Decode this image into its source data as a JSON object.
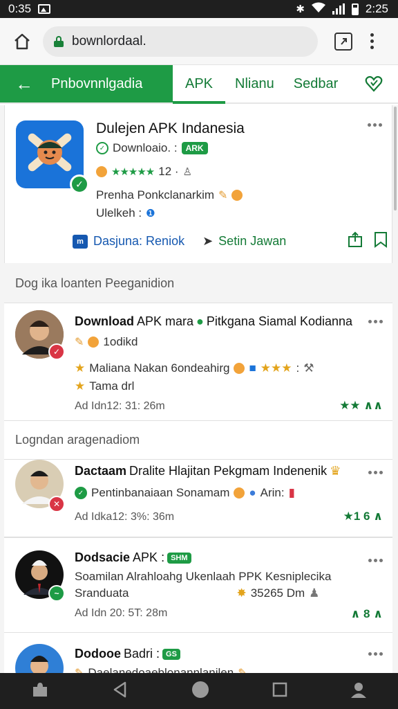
{
  "status_bar": {
    "left_time": "0:35",
    "right_time": "2:25"
  },
  "browser": {
    "url": "bownlordaal."
  },
  "tabs": [
    {
      "label": "Pnbovnnlgadia",
      "active": true
    },
    {
      "label": "APK"
    },
    {
      "label": "Nlianu"
    },
    {
      "label": "Sedbar"
    }
  ],
  "app": {
    "title": "Dulejen APK Indanesia",
    "meta_label": "Downloaio. :",
    "meta_badge": "ARK",
    "rating_count": "12 ·",
    "description": "Prenha Ponkclanarkim",
    "detail": "Ulelkeh :",
    "primary_action": "Dasjuna: Reniok",
    "primary_action_icon": "m",
    "secondary_action": "Setin Jawan"
  },
  "section_headers": [
    "Dog ika loanten Peeganidion",
    "Logndan aragenadiom"
  ],
  "items": [
    {
      "title_bold": "Download",
      "title_rest": "APK mara",
      "title_tail": "Pitkgana Siamal Kodianna",
      "subline": "1odikd",
      "text_line1": "Maliana Nakan 6ondeahirg",
      "text_line1_tail": ":",
      "text_line2": "Tama drl",
      "time": "Ad Idn12: 31: 26m",
      "stats": "★★ ∧∧",
      "avatar_badge_color": "#d93545"
    },
    {
      "title_bold": "Dactaam",
      "title_rest": "Dralite Hlajitan Pekgmam Indenenik",
      "subline": "Pentinbanaiaan Sonamam",
      "subline_tail": "Arin:",
      "time": "Ad Idka12: 3%: 36m",
      "stats": "★1 6 ∧",
      "avatar_badge_color": "#d93545"
    },
    {
      "title_bold": "Dodsacie",
      "title_rest": "APK :",
      "title_badge": "SHM",
      "text_line1": "Soamilan Alrahloahg Ukenlaah PPK Kesniplecika",
      "text_line2": "Sranduata",
      "text_line2_tail": "35265 Dm",
      "time": "Ad Idn 20: 5T: 28m",
      "stats": "∧ 8 ∧",
      "avatar_badge_color": "#1e9b45"
    },
    {
      "title_bold": "Dodooe",
      "title_rest": "Badri :",
      "title_badge": "GS",
      "text_line1": "Daelanedoaeblonannlanilen",
      "avatar_badge_color": "#1e9b45"
    }
  ],
  "colors": {
    "brand_green": "#1e9b45",
    "link_blue": "#1558b0",
    "status_bg": "#1f1f1f"
  },
  "icons": [
    "home-icon",
    "lock-icon",
    "tabs-icon",
    "more-icon",
    "back-arrow-icon",
    "heart-icon",
    "share-icon",
    "bookmark-icon",
    "puzzle-icon",
    "back-triangle-icon",
    "home-circle-icon",
    "recents-square-icon",
    "profile-icon"
  ]
}
